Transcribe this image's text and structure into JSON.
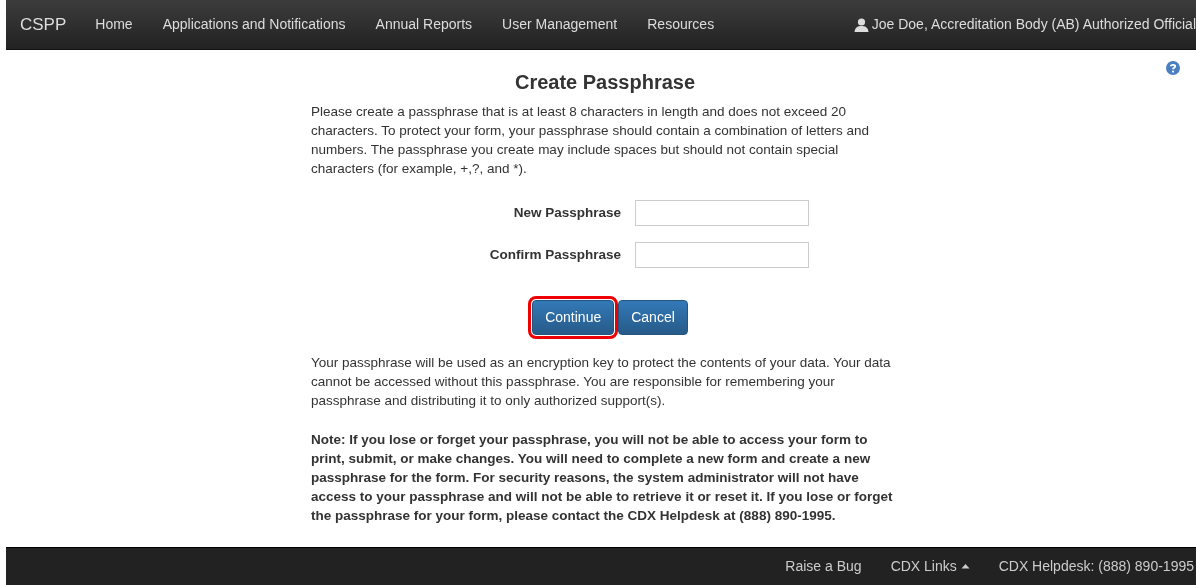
{
  "navbar": {
    "brand": "CSPP",
    "items": [
      {
        "label": "Home"
      },
      {
        "label": "Applications and Notifications"
      },
      {
        "label": "Annual Reports"
      },
      {
        "label": "User Management"
      },
      {
        "label": "Resources"
      }
    ],
    "user": "Joe Doe, Accreditation Body (AB) Authorized Official"
  },
  "title": "Create Passphrase",
  "intro": "Please create a passphrase that is at least 8 characters in length and does not exceed 20 characters. To protect your form, your passphrase should contain a combination of letters and numbers. The passphrase you create may include spaces but should not contain special characters (for example, +,?, and *).",
  "fields": [
    {
      "label": "New Passphrase"
    },
    {
      "label": "Confirm Passphrase"
    }
  ],
  "buttons": [
    {
      "label": "Continue",
      "highlighted": true
    },
    {
      "label": "Cancel",
      "highlighted": false
    }
  ],
  "info": "Your passphrase will be used as an encryption key to protect the contents of your data. Your data cannot be accessed without this passphrase. You are responsible for remembering your passphrase and distributing it to only authorized support(s).",
  "note": "Note: If you lose or forget your passphrase, you will not be able to access your form to print, submit, or make changes. You will need to complete a new form and create a new passphrase for the form. For security reasons, the system administrator will not have access to your passphrase and will not be able to retrieve it or reset it. If you lose or forget the passphrase for your form, please contact the CDX Helpdesk at (888) 890-1995.",
  "footer": [
    {
      "label": "Raise a Bug",
      "kind": "link"
    },
    {
      "label": "CDX Links",
      "kind": "dropdown"
    },
    {
      "label": "CDX Helpdesk: (888) 890-1995",
      "kind": "text"
    }
  ]
}
